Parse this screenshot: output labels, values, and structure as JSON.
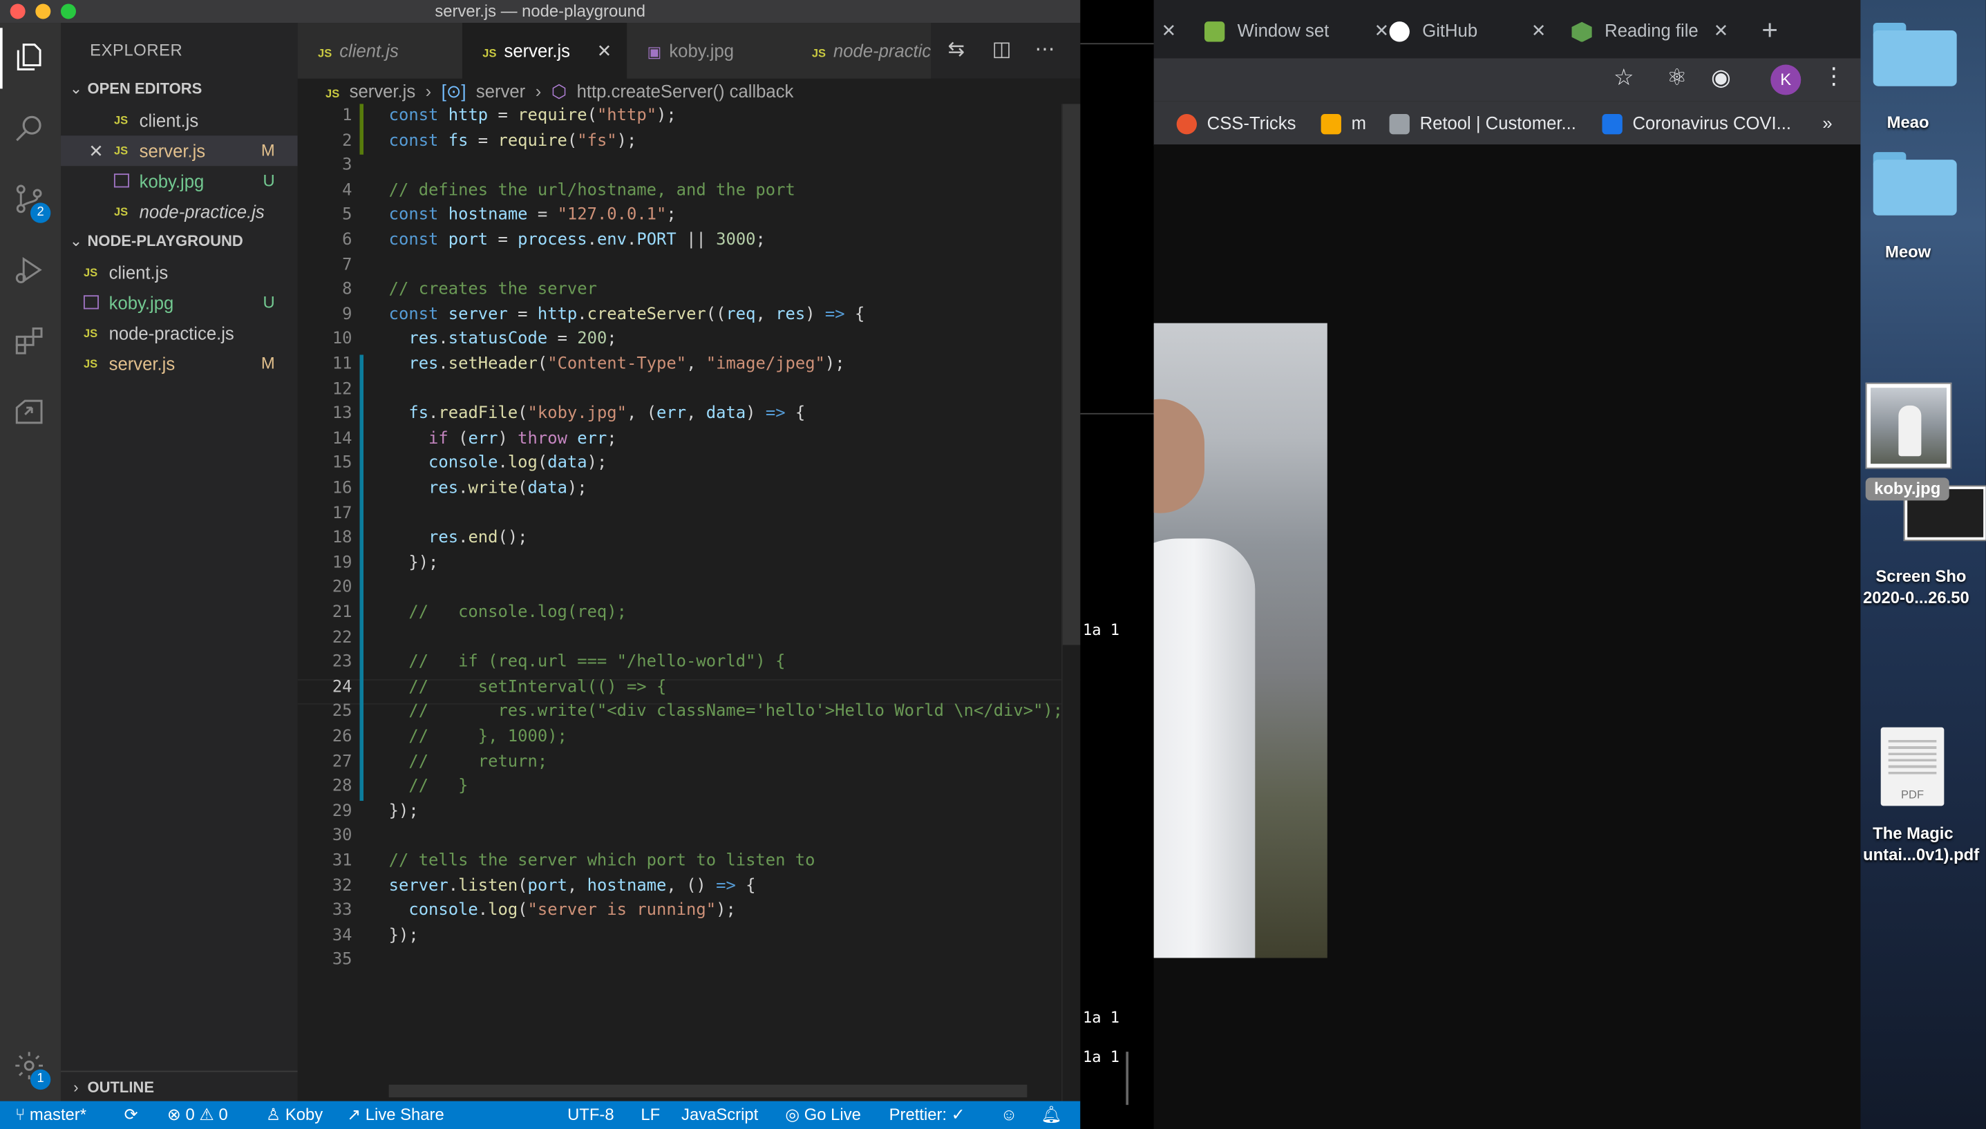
{
  "window_title": "server.js — node-playground",
  "explorer": {
    "title": "EXPLORER",
    "open_editors_label": "OPEN EDITORS",
    "open_editors": [
      {
        "name": "client.js",
        "type": "js",
        "status": "",
        "italic": false
      },
      {
        "name": "server.js",
        "type": "js",
        "status": "M",
        "italic": false
      },
      {
        "name": "koby.jpg",
        "type": "img",
        "status": "U",
        "italic": false
      },
      {
        "name": "node-practice.js",
        "type": "js",
        "status": "",
        "italic": true
      }
    ],
    "project_label": "NODE-PLAYGROUND",
    "files": [
      {
        "name": "client.js",
        "type": "js",
        "status": ""
      },
      {
        "name": "koby.jpg",
        "type": "img",
        "status": "U"
      },
      {
        "name": "node-practice.js",
        "type": "js",
        "status": ""
      },
      {
        "name": "server.js",
        "type": "js",
        "status": "M"
      }
    ],
    "outline_label": "OUTLINE"
  },
  "activity": {
    "scm_badge": "2",
    "settings_badge": "1"
  },
  "tabs": [
    {
      "label": "client.js",
      "active": false,
      "italic": true
    },
    {
      "label": "server.js",
      "active": true,
      "italic": false
    },
    {
      "label": "koby.jpg",
      "active": false,
      "italic": false
    },
    {
      "label": "node-practice.js",
      "active": false,
      "italic": true
    }
  ],
  "tab_icon": "JS",
  "breadcrumbs": [
    "server.js",
    "server",
    "http.createServer() callback"
  ],
  "code_lines": [
    "const http = require(\"http\");",
    "const fs = require(\"fs\");",
    "",
    "// defines the url/hostname, and the port",
    "const hostname = \"127.0.0.1\";",
    "const port = process.env.PORT || 3000;",
    "",
    "// creates the server",
    "const server = http.createServer((req, res) => {",
    "  res.statusCode = 200;",
    "  res.setHeader(\"Content-Type\", \"image/jpeg\");",
    "",
    "  fs.readFile(\"koby.jpg\", (err, data) => {",
    "    if (err) throw err;",
    "    console.log(data);",
    "    res.write(data);",
    "",
    "    res.end();",
    "  });",
    "",
    "  //   console.log(req);",
    "",
    "  //   if (req.url === \"/hello-world\") {",
    "  //     setInterval(() => {",
    "  //       res.write(\"<div className='hello'>Hello World \\n</div>\");",
    "  //     }, 1000);",
    "  //     return;",
    "  //   }",
    "});",
    "",
    "// tells the server which port to listen to",
    "server.listen(port, hostname, () => {",
    "  console.log(\"server is running\");",
    "});",
    ""
  ],
  "current_line": 24,
  "statusbar": {
    "branch": "master*",
    "errors": "0",
    "warnings": "0",
    "user": "Koby",
    "live_share": "Live Share",
    "encoding": "UTF-8",
    "eol": "LF",
    "language": "JavaScript",
    "go_live": "Go Live",
    "prettier": "Prettier: ✓"
  },
  "terminal": {
    "lines": [
      "1a 1",
      "1a 1",
      "1a 1"
    ]
  },
  "chrome": {
    "tabs": [
      "Window set",
      "GitHub",
      "Reading file"
    ],
    "profile_initial": "K",
    "bookmarks": [
      "CSS-Tricks",
      "m",
      "Retool | Customer...",
      "Coronavirus COVI..."
    ],
    "more": "»"
  },
  "desktop": {
    "items": [
      "Meao",
      "Meow",
      "koby.jpg",
      "Screen Sho",
      "2020-0...26.50",
      "The Magic",
      "untai...0v1).pdf"
    ],
    "pdf_label": "PDF"
  },
  "colors": {
    "accent": "#007acc",
    "modified": "#e2c08d",
    "untracked": "#73c991"
  }
}
